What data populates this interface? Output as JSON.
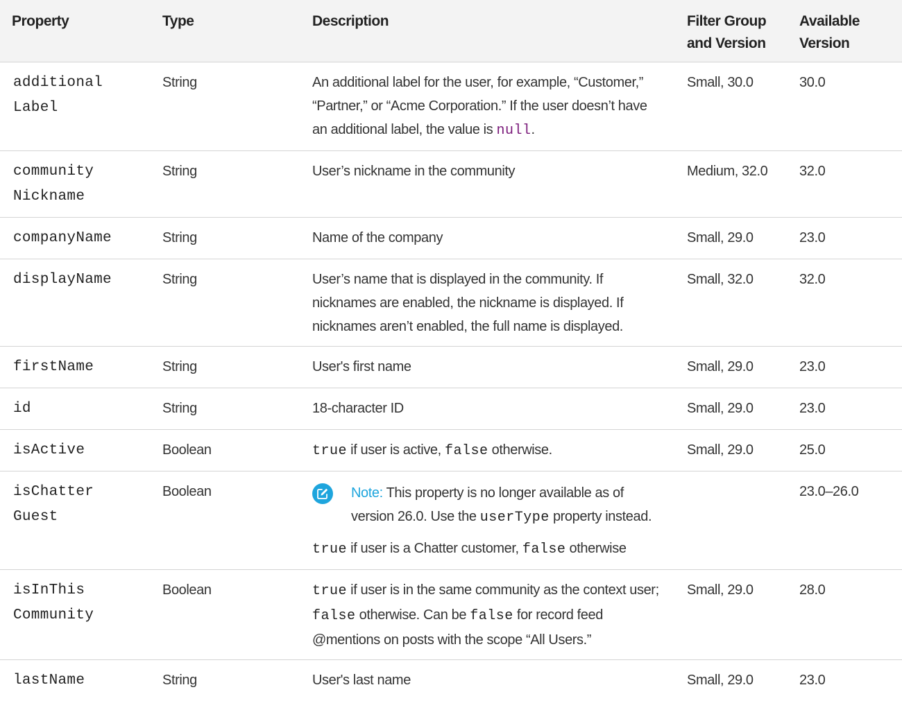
{
  "headers": {
    "property": "Property",
    "type": "Type",
    "description": "Description",
    "filter_group": "Filter Group and Version",
    "available_version": "Available Version"
  },
  "rows": [
    {
      "property": "additional\nLabel",
      "type": "String",
      "desc_before": "An additional label for the user, for example, “Customer,” “Partner,” or “Acme Corporation.” If the user doesn’t have an additional label, the value is",
      "desc_code": "null",
      "desc_after": ".",
      "filter_group": "Small, 30.0",
      "version": "30.0"
    },
    {
      "property": "community\nNickname",
      "type": "String",
      "description": "User’s nickname in the community",
      "filter_group": "Medium, 32.0",
      "version": "32.0"
    },
    {
      "property": "companyName",
      "type": "String",
      "description": "Name of the company",
      "filter_group": "Small, 29.0",
      "version": "23.0"
    },
    {
      "property": "displayName",
      "type": "String",
      "description": "User’s name that is displayed in the community. If nicknames are enabled, the nickname is displayed. If nicknames aren’t enabled, the full name is displayed.",
      "filter_group": "Small, 32.0",
      "version": "32.0"
    },
    {
      "property": "firstName",
      "type": "String",
      "description": "User's first name",
      "filter_group": "Small, 29.0",
      "version": "23.0"
    },
    {
      "property": "id",
      "type": "String",
      "description": "18-character ID",
      "filter_group": "Small, 29.0",
      "version": "23.0"
    },
    {
      "property": "isActive",
      "type": "Boolean",
      "code_true": "true",
      "text_1": " if user is active, ",
      "code_false": "false",
      "text_2": " otherwise.",
      "filter_group": "Small, 29.0",
      "version": "25.0"
    },
    {
      "property": "isChatter\nGuest",
      "type": "Boolean",
      "note_label": "Note:",
      "note_text_1": " This property is no longer available as of version 26.0. Use the ",
      "note_code": "userType",
      "note_text_2": " property instead.",
      "code_true": "true",
      "text_1": " if user is a Chatter customer, ",
      "code_false": "false",
      "text_2": " otherwise",
      "filter_group": "",
      "version": "23.0–26.0"
    },
    {
      "property": "isInThis\nCommunity",
      "type": "Boolean",
      "code_true": "true",
      "text_1": " if user is in the same community as the context user; ",
      "code_false": "false",
      "text_2": " otherwise. Can be ",
      "code_false_2": "false",
      "text_3": " for record feed @mentions on posts with the scope “All Users.”",
      "filter_group": "Small, 29.0",
      "version": "28.0"
    },
    {
      "property": "lastName",
      "type": "String",
      "description": "User's last name",
      "filter_group": "Small, 29.0",
      "version": "23.0"
    }
  ],
  "colors": {
    "header_bg": "#f3f3f3",
    "border": "#d4d4d4",
    "note_accent": "#1ea5dd",
    "null_code": "#7a1a7a"
  },
  "icons": {
    "note": "edit-pencil-icon"
  }
}
